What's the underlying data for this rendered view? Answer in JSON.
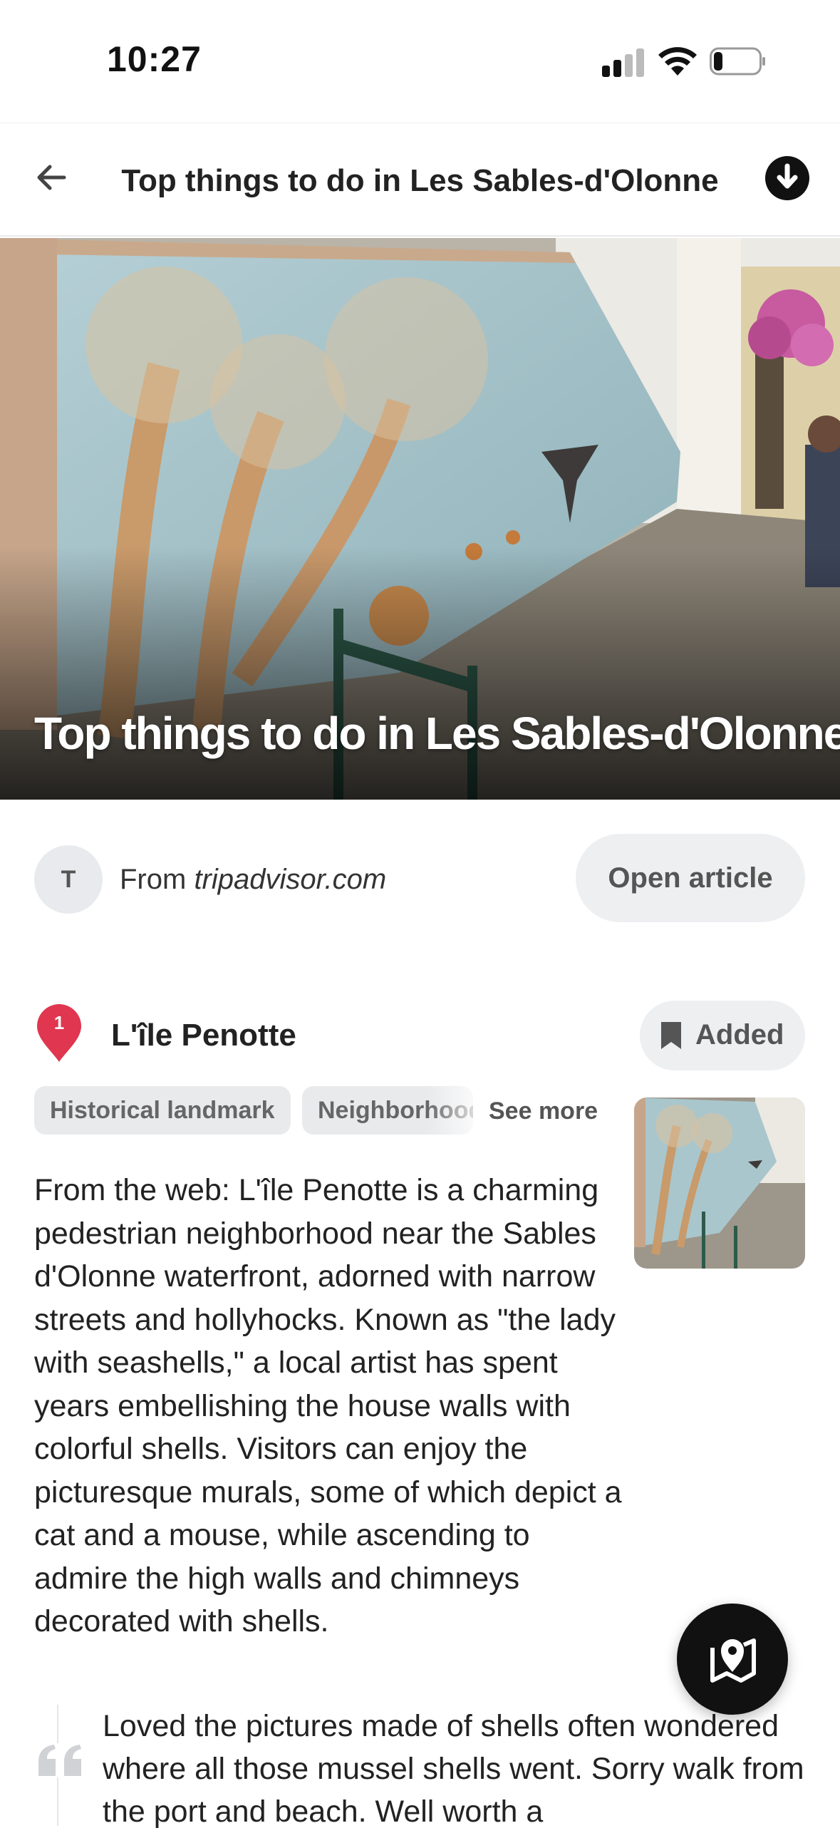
{
  "status_bar": {
    "time": "10:27",
    "icons": [
      "signal-icon",
      "wifi-icon",
      "battery-icon"
    ]
  },
  "nav": {
    "title": "Top things to do in Les Sables-d'Olonne",
    "back_icon": "arrow-left-icon",
    "download_icon": "download-icon"
  },
  "hero": {
    "title": "Top things to do in Les Sables-d'Olonne"
  },
  "source": {
    "avatar_letter": "T",
    "prefix": "From ",
    "site": "tripadvisor.com",
    "open_article_label": "Open article"
  },
  "item": {
    "number": "1",
    "title": "L'île Penotte",
    "added_label": "Added",
    "tags": [
      "Historical landmark",
      "Neighborhood"
    ],
    "see_more_label": "See more",
    "description": "From the web: L'île Penotte is a charming pedestrian neighborhood near the Sables d'Olonne waterfront, adorned with narrow streets and hollyhocks. Known as \"the lady with seashells,\" a local artist has spent years embellishing the house walls with colorful shells. Visitors can enjoy the picturesque murals, some of which depict a cat and a mouse, while ascending to admire the high walls and chimneys decorated with shells.",
    "review": "Loved the pictures made of shells often wondered where all those mussel shells went. Sorry walk from the port and beach. Well worth a"
  },
  "map_button": {
    "icon": "map-pin-icon"
  },
  "colors": {
    "pin": "#e0364f",
    "wall": "#a8c5cc",
    "button_bg": "#eeeff1",
    "fab": "#111111"
  }
}
